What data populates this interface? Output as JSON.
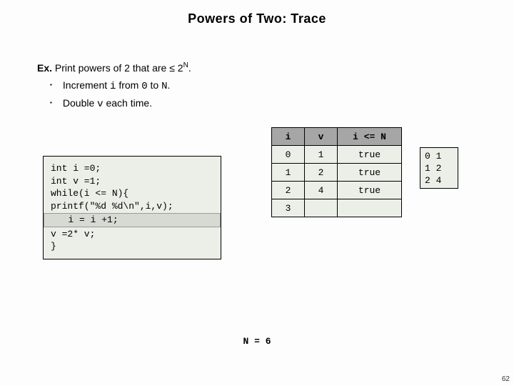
{
  "title": "Powers of Two:  Trace",
  "ex_label": "Ex.",
  "ex_text_pre": "  Print powers of 2 that are ",
  "ex_le": "≤",
  "ex_base": " 2",
  "ex_exp": "N",
  "ex_post": ".",
  "bullet1_pre": "Increment ",
  "bullet1_var": "i",
  "bullet1_mid": " from ",
  "bullet1_zero": "0",
  "bullet1_to": " to ",
  "bullet1_N": "N",
  "bullet1_post": ".",
  "bullet2_pre": "Double ",
  "bullet2_var": "v",
  "bullet2_post": " each time.",
  "code_line1": "int i =0;",
  "code_line2": "int v =1;",
  "code_line3": "while(i <= N){",
  "code_line4": "printf(\"%d %d\\n\",i,v);",
  "code_line5": "   i = i +1;",
  "code_line6": "v =2* v;",
  "code_line7": "}",
  "table": {
    "h1": "i",
    "h2": "v",
    "h3": "i <= N",
    "rows": [
      {
        "i": "0",
        "v": "1",
        "c": "true"
      },
      {
        "i": "1",
        "v": "2",
        "c": "true"
      },
      {
        "i": "2",
        "v": "4",
        "c": "true"
      },
      {
        "i": "3",
        "v": "",
        "c": ""
      }
    ]
  },
  "output": "0 1\n1 2\n2 4",
  "n_footer": "N = 6",
  "pagenum": "62",
  "chart_data": {
    "type": "table",
    "title": "Trace table for powers of two",
    "columns": [
      "i",
      "v",
      "i <= N"
    ],
    "rows": [
      [
        0,
        1,
        "true"
      ],
      [
        1,
        2,
        "true"
      ],
      [
        2,
        4,
        "true"
      ],
      [
        3,
        null,
        null
      ]
    ],
    "N": 6,
    "printed_output": [
      [
        0,
        1
      ],
      [
        1,
        2
      ],
      [
        2,
        4
      ]
    ]
  }
}
